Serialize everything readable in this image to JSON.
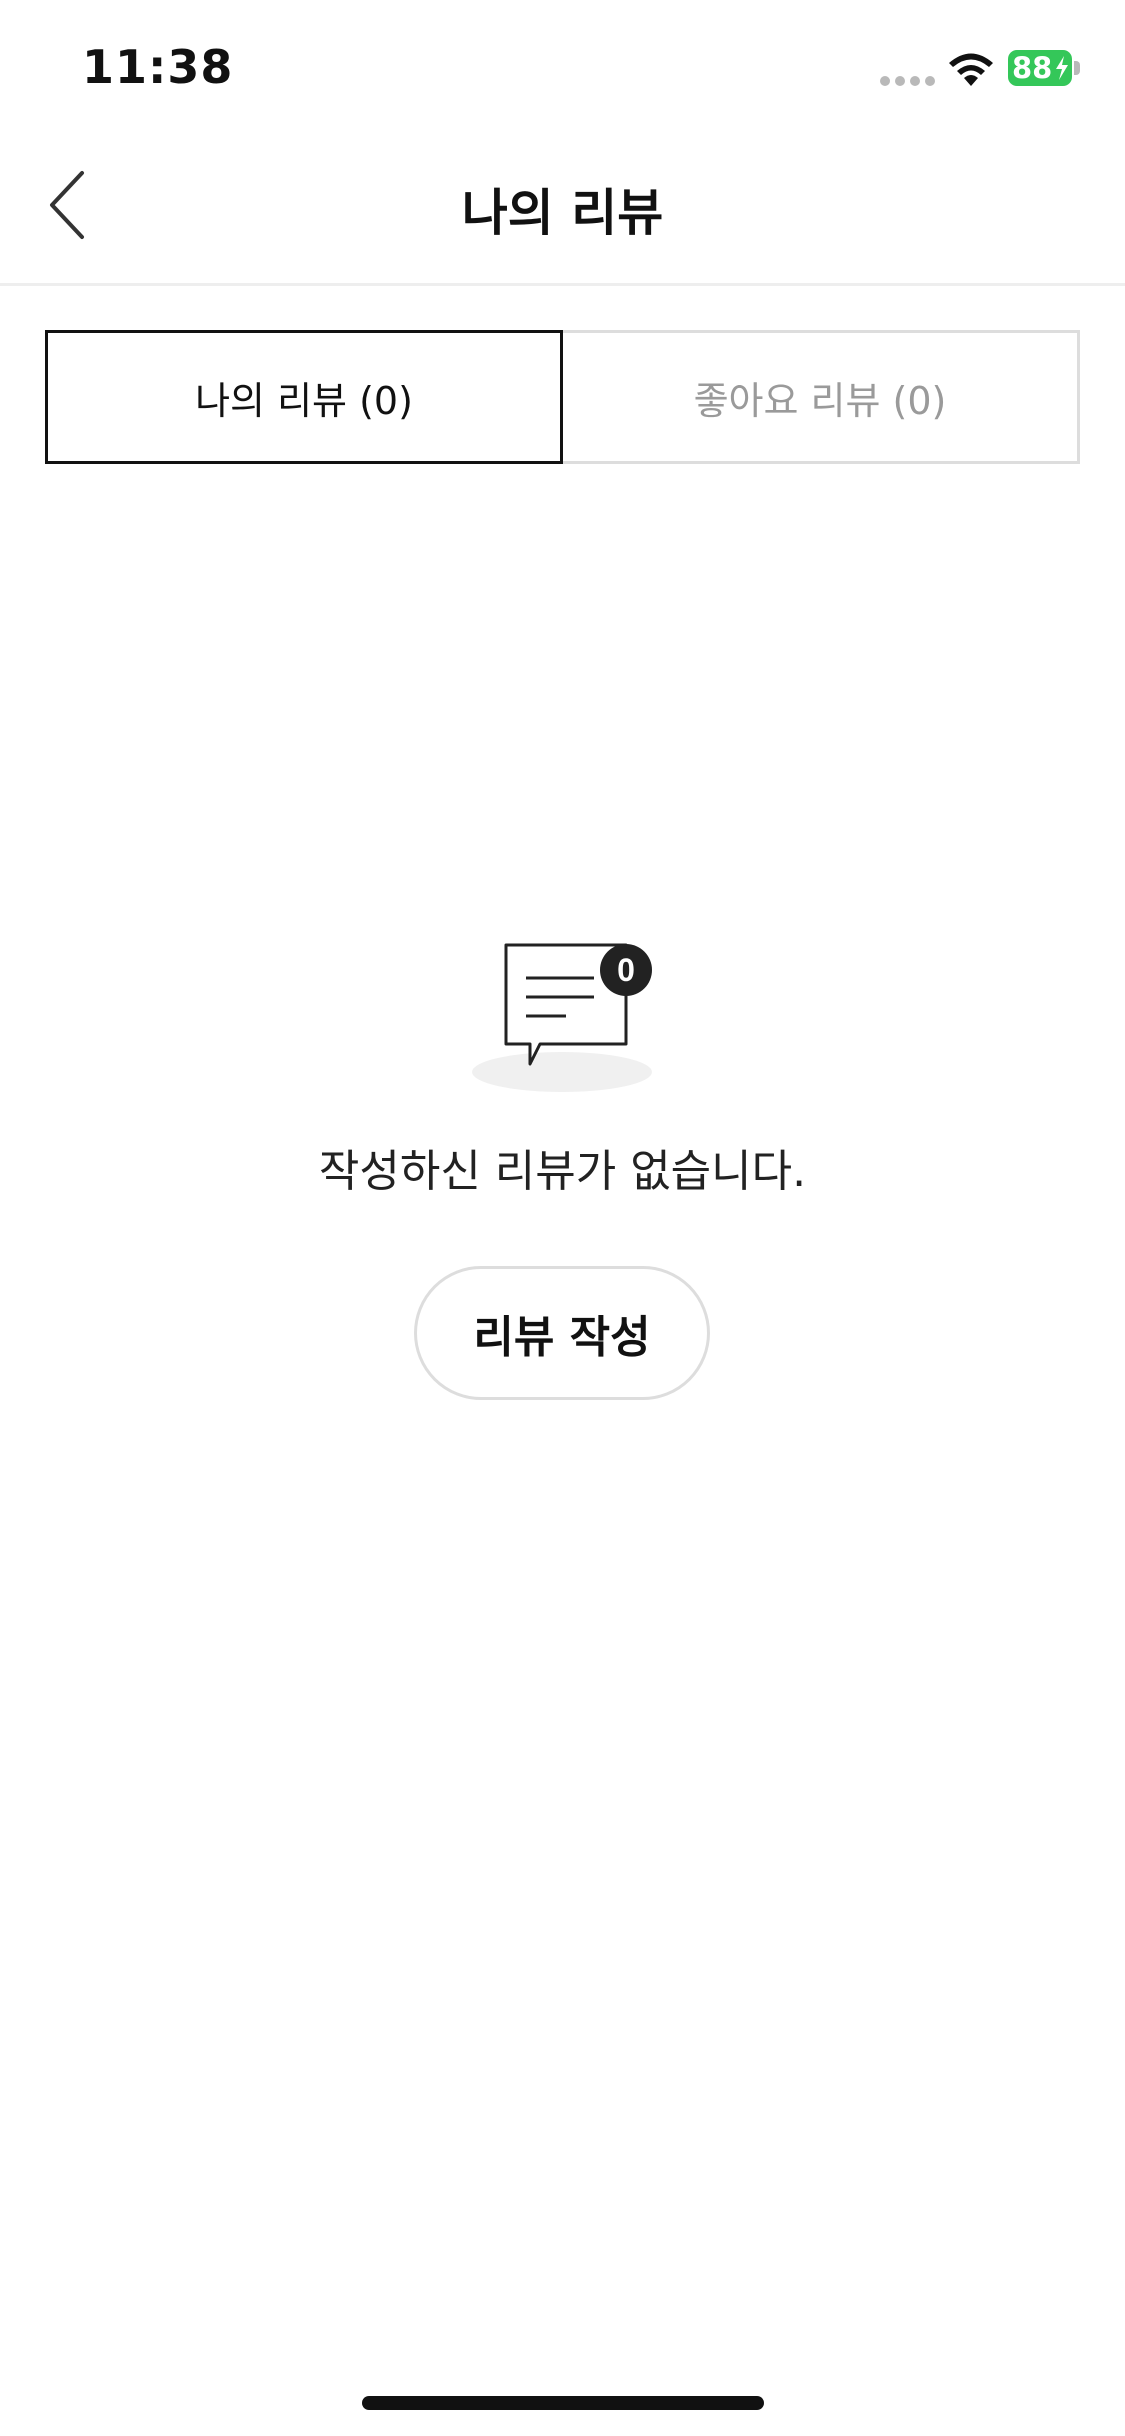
{
  "status_bar": {
    "time": "11:38",
    "battery_level": "88",
    "battery_color": "#34c759",
    "icons": [
      "signal-dots-icon",
      "wifi-icon",
      "battery-icon",
      "charging-bolt-icon"
    ]
  },
  "header": {
    "title": "나의 리뷰",
    "back_icon": "chevron-left-icon"
  },
  "tabs": [
    {
      "label": "나의 리뷰 (0)",
      "active": true
    },
    {
      "label": "좋아요 리뷰 (0)",
      "active": false
    }
  ],
  "empty_state": {
    "icon": "speech-bubble-lines-icon",
    "badge_count": "0",
    "message": "작성하신 리뷰가 없습니다.",
    "button_label": "리뷰 작성"
  }
}
